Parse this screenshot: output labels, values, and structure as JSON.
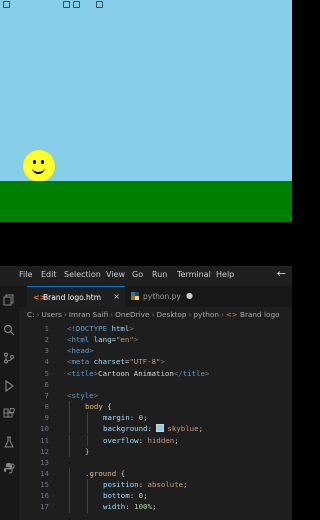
{
  "colors": {
    "sky": "#87ceeb",
    "ground": "#008000",
    "sun": "#ffff2d",
    "editor_bg": "#1e1e1e",
    "accent": "#0078d4"
  },
  "preview": {
    "icons": [
      "toolbar-icon",
      "toolbar-icon",
      "toolbar-icon",
      "toolbar-icon"
    ]
  },
  "menubar": {
    "items": [
      "File",
      "Edit",
      "Selection",
      "View",
      "Go",
      "Run",
      "Terminal",
      "Help"
    ],
    "back_icon": "arrow-left-icon"
  },
  "activity_bar": {
    "icons": [
      "copy-icon",
      "search-icon",
      "source-control-icon",
      "run-debug-icon",
      "extensions-icon",
      "flask-icon",
      "python-icon"
    ]
  },
  "tabs": [
    {
      "label": "Brand logo.htm",
      "icon": "html-icon",
      "active": true,
      "close": "×"
    },
    {
      "label": "python.py",
      "icon": "python-icon",
      "active": false,
      "modified": "●"
    }
  ],
  "breadcrumb": {
    "parts": [
      "C:",
      "Users",
      "Imran Saifi",
      "OneDrive",
      "Desktop",
      "python",
      "Brand logo"
    ]
  },
  "editor": {
    "lines": [
      {
        "n": "1",
        "indent": 1,
        "tokens": [
          [
            "punc",
            "<"
          ],
          [
            "tag",
            "!DOCTYPE"
          ],
          [
            "txt",
            " "
          ],
          [
            "attr",
            "html"
          ],
          [
            "punc",
            ">"
          ]
        ]
      },
      {
        "n": "2",
        "indent": 1,
        "tokens": [
          [
            "punc",
            "<"
          ],
          [
            "tag",
            "html"
          ],
          [
            "txt",
            " "
          ],
          [
            "attr",
            "lang"
          ],
          [
            "txt",
            "="
          ],
          [
            "str",
            "\"en\""
          ],
          [
            "punc",
            ">"
          ]
        ]
      },
      {
        "n": "3",
        "indent": 1,
        "tokens": [
          [
            "punc",
            "<"
          ],
          [
            "tag",
            "head"
          ],
          [
            "punc",
            ">"
          ]
        ]
      },
      {
        "n": "4",
        "indent": 1,
        "tokens": [
          [
            "punc",
            "<"
          ],
          [
            "tag",
            "meta"
          ],
          [
            "txt",
            " "
          ],
          [
            "attr",
            "charset"
          ],
          [
            "txt",
            "="
          ],
          [
            "str",
            "\"UTF-8\""
          ],
          [
            "punc",
            ">"
          ]
        ]
      },
      {
        "n": "5",
        "indent": 1,
        "tokens": [
          [
            "punc",
            "<"
          ],
          [
            "tag",
            "title"
          ],
          [
            "punc",
            ">"
          ],
          [
            "txt",
            "Cartoon Animation"
          ],
          [
            "punc",
            "</"
          ],
          [
            "tag",
            "title"
          ],
          [
            "punc",
            ">"
          ]
        ]
      },
      {
        "n": "6",
        "indent": 0,
        "tokens": []
      },
      {
        "n": "7",
        "indent": 1,
        "tokens": [
          [
            "punc",
            "<"
          ],
          [
            "tag",
            "style"
          ],
          [
            "punc",
            ">"
          ]
        ]
      },
      {
        "n": "8",
        "indent": 2,
        "tokens": [
          [
            "sel",
            "body"
          ],
          [
            "txt",
            " {"
          ]
        ]
      },
      {
        "n": "9",
        "indent": 3,
        "tokens": [
          [
            "prop",
            "margin"
          ],
          [
            "txt",
            ": "
          ],
          [
            "num",
            "0"
          ],
          [
            "txt",
            ";"
          ]
        ]
      },
      {
        "n": "10",
        "indent": 3,
        "tokens": [
          [
            "prop",
            "background"
          ],
          [
            "txt",
            ": "
          ],
          [
            "swatch",
            ""
          ],
          [
            "val",
            "skyblue"
          ],
          [
            "txt",
            ";"
          ]
        ]
      },
      {
        "n": "11",
        "indent": 3,
        "tokens": [
          [
            "prop",
            "overflow"
          ],
          [
            "txt",
            ": "
          ],
          [
            "val",
            "hidden"
          ],
          [
            "txt",
            ";"
          ]
        ]
      },
      {
        "n": "12",
        "indent": 2,
        "tokens": [
          [
            "txt",
            "}"
          ]
        ]
      },
      {
        "n": "13",
        "indent": 0,
        "tokens": []
      },
      {
        "n": "14",
        "indent": 2,
        "tokens": [
          [
            "sel",
            ".ground"
          ],
          [
            "txt",
            " {"
          ]
        ]
      },
      {
        "n": "15",
        "indent": 3,
        "tokens": [
          [
            "prop",
            "position"
          ],
          [
            "txt",
            ": "
          ],
          [
            "val",
            "absolute"
          ],
          [
            "txt",
            ";"
          ]
        ]
      },
      {
        "n": "16",
        "indent": 3,
        "tokens": [
          [
            "prop",
            "bottom"
          ],
          [
            "txt",
            ": "
          ],
          [
            "num",
            "0"
          ],
          [
            "txt",
            ";"
          ]
        ]
      },
      {
        "n": "17",
        "indent": 3,
        "tokens": [
          [
            "prop",
            "width"
          ],
          [
            "txt",
            ": "
          ],
          [
            "num",
            "100%"
          ],
          [
            "txt",
            ";"
          ]
        ]
      }
    ]
  }
}
